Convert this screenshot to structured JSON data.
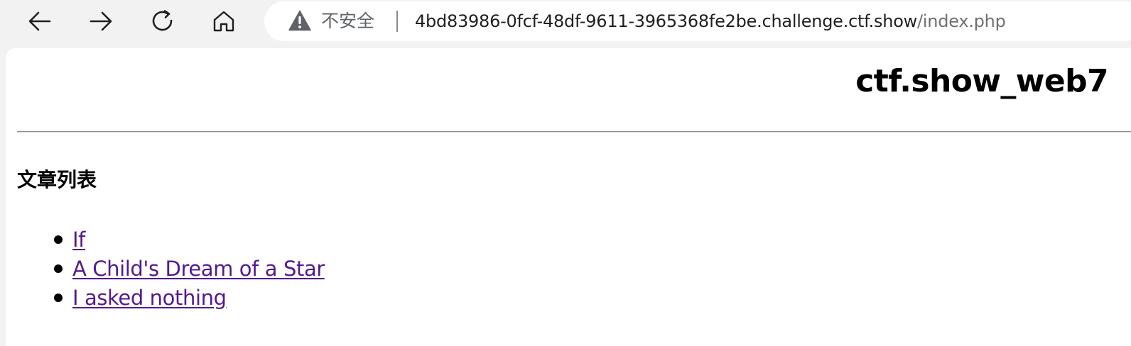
{
  "browser": {
    "nav_icons": {
      "back": "arrow-left",
      "forward": "arrow-right",
      "reload": "reload",
      "home": "home"
    },
    "security_icon": "warning-triangle",
    "security_label": "不安全",
    "url_host": "4bd83986-0fcf-48df-9611-3965368fe2be.challenge.ctf.show",
    "url_path": "/index.php"
  },
  "page": {
    "heading": "ctf.show_web7",
    "section_title": "文章列表",
    "articles": [
      {
        "title": "If"
      },
      {
        "title": "A Child's Dream of a Star"
      },
      {
        "title": "I asked nothing"
      }
    ],
    "link_color": "#551a8b"
  }
}
